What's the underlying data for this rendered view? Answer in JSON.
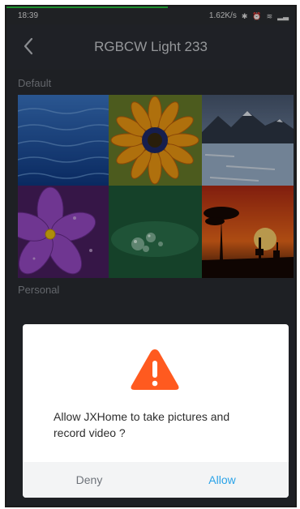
{
  "status_bar": {
    "time": "18:39",
    "speed": "1.62K/s",
    "icons": [
      "bluetooth-icon",
      "alarm-icon",
      "wifi-icon",
      "signal-icon"
    ],
    "download_progress": 0.56
  },
  "header": {
    "back_icon": "chevron-left-icon",
    "title": "RGBCW Light 233"
  },
  "sections": {
    "default_label": "Default",
    "personal_label": "Personal"
  },
  "gallery": {
    "tiles": [
      {
        "name": "ocean-water"
      },
      {
        "name": "orange-daisy"
      },
      {
        "name": "mountain-lake"
      },
      {
        "name": "purple-flower"
      },
      {
        "name": "water-droplets"
      },
      {
        "name": "sunset-savanna"
      }
    ]
  },
  "dialog": {
    "icon": "warning-icon",
    "message": "Allow JXHome to take pictures and record video ?",
    "deny_label": "Deny",
    "allow_label": "Allow",
    "accent_color": "#ff5a1f",
    "allow_color": "#2aa3e8"
  }
}
